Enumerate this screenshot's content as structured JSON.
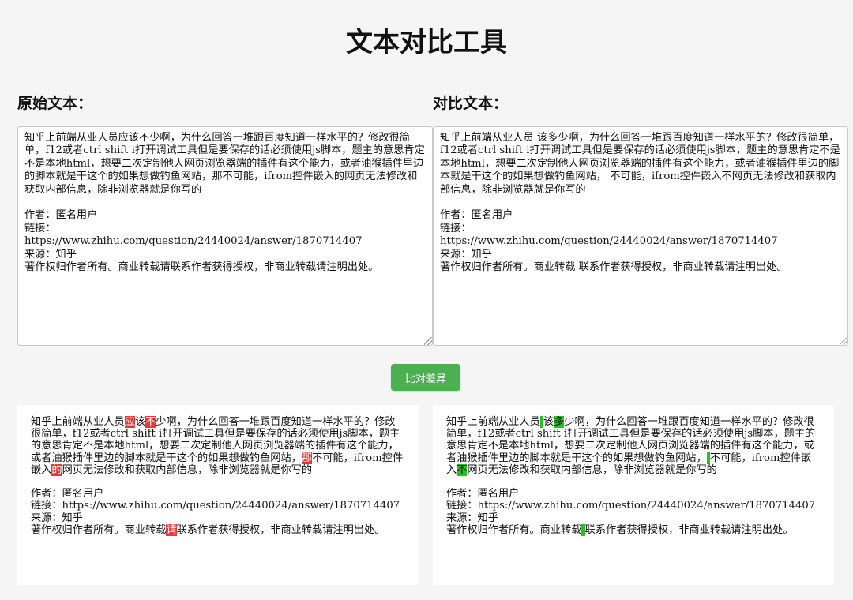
{
  "page_title": "文本对比工具",
  "original_label": "原始文本：",
  "compare_label": "对比文本：",
  "original_text": "知乎上前端从业人员应该不少啊，为什么回答一堆跟百度知道一样水平的？修改很简单，f12或者ctrl shift i打开调试工具但是要保存的话必须使用js脚本，题主的意思肯定不是本地html，想要二次定制他人网页浏览器端的插件有这个能力，或者油猴插件里边的脚本就是干这个的如果想做钓鱼网站，那不可能，ifrom控件嵌入的网页无法修改和获取内部信息，除非浏览器就是你写的\n\n作者：匿名用户\n链接：\nhttps://www.zhihu.com/question/24440024/answer/1870714407\n来源：知乎\n著作权归作者所有。商业转载请联系作者获得授权，非商业转载请注明出处。",
  "compare_text": "知乎上前端从业人员 该多少啊，为什么回答一堆跟百度知道一样水平的？修改很简单，f12或者ctrl shift i打开调试工具但是要保存的话必须使用js脚本，题主的意思肯定不是本地html，想要二次定制他人网页浏览器端的插件有这个能力，或者油猴插件里边的脚本就是干这个的如果想做钓鱼网站， 不可能，ifrom控件嵌入不网页无法修改和获取内部信息，除非浏览器就是你写的\n\n作者：匿名用户\n链接：\nhttps://www.zhihu.com/question/24440024/answer/1870714407\n来源：知乎\n著作权归作者所有。商业转载 联系作者获得授权，非商业转载请注明出处。",
  "compare_button": "比对差异",
  "result_left": [
    {
      "t": "知乎上前端从业人员"
    },
    {
      "t": "应",
      "d": "del"
    },
    {
      "t": "该"
    },
    {
      "t": "不",
      "d": "del"
    },
    {
      "t": "少啊，为什么回答一堆跟百度知道一样水平的？修改很简单，f12或者ctrl shift i打开调试工具但是要保存的话必须使用js脚本，题主的意思肯定不是本地html，想要二次定制他人网页浏览器端的插件有这个能力，或者油猴插件里边的脚本就是干这个的如果想做钓鱼网站，"
    },
    {
      "t": "那",
      "d": "del"
    },
    {
      "t": "不可能，ifrom控件嵌入"
    },
    {
      "t": "的",
      "d": "del"
    },
    {
      "t": "网页无法修改和获取内部信息，除非浏览器就是你写的\n\n作者：匿名用户\n链接：https://www.zhihu.com/question/24440024/answer/1870714407\n来源：知乎\n著作权归作者所有。商业转载"
    },
    {
      "t": "请",
      "d": "del"
    },
    {
      "t": "联系作者获得授权，非商业转载请注明出处。"
    }
  ],
  "result_right": [
    {
      "t": "知乎上前端从业人员"
    },
    {
      "t": " ",
      "d": "ins"
    },
    {
      "t": "该"
    },
    {
      "t": "多",
      "d": "ins"
    },
    {
      "t": "少啊，为什么回答一堆跟百度知道一样水平的？修改很简单，f12或者ctrl shift i打开调试工具但是要保存的话必须使用js脚本，题主的意思肯定不是本地html，想要二次定制他人网页浏览器端的插件有这个能力，或者油猴插件里边的脚本就是干这个的如果想做钓鱼网站，"
    },
    {
      "t": " ",
      "d": "ins"
    },
    {
      "t": "不可能，ifrom控件嵌入"
    },
    {
      "t": "不",
      "d": "ins"
    },
    {
      "t": "网页无法修改和获取内部信息，除非浏览器就是你写的\n\n作者：匿名用户\n链接：https://www.zhihu.com/question/24440024/answer/1870714407\n来源：知乎\n著作权归作者所有。商业转载"
    },
    {
      "t": " ",
      "d": "ins"
    },
    {
      "t": "联系作者获得授权，非商业转载请注明出处。"
    }
  ],
  "colors": {
    "deleted_highlight": "#e53935",
    "inserted_highlight": "#22c322",
    "button_bg": "#4caf50"
  }
}
